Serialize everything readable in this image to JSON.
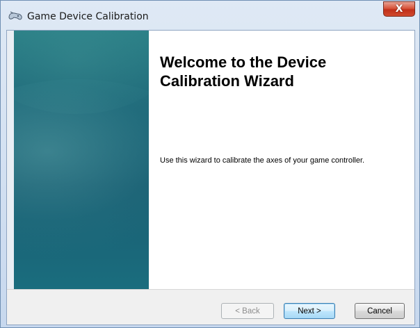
{
  "window": {
    "title": "Game Device Calibration",
    "close_label": "X",
    "icon": "game-controller-icon"
  },
  "wizard": {
    "heading": "Welcome to the Device Calibration Wizard",
    "description": "Use this wizard to calibrate the axes of your game controller."
  },
  "buttons": {
    "back": "< Back",
    "next": "Next >",
    "cancel": "Cancel"
  },
  "colors": {
    "panel_teal": "#1d6778",
    "close_red": "#c1301a",
    "default_button_blue": "#3c7fb1"
  }
}
